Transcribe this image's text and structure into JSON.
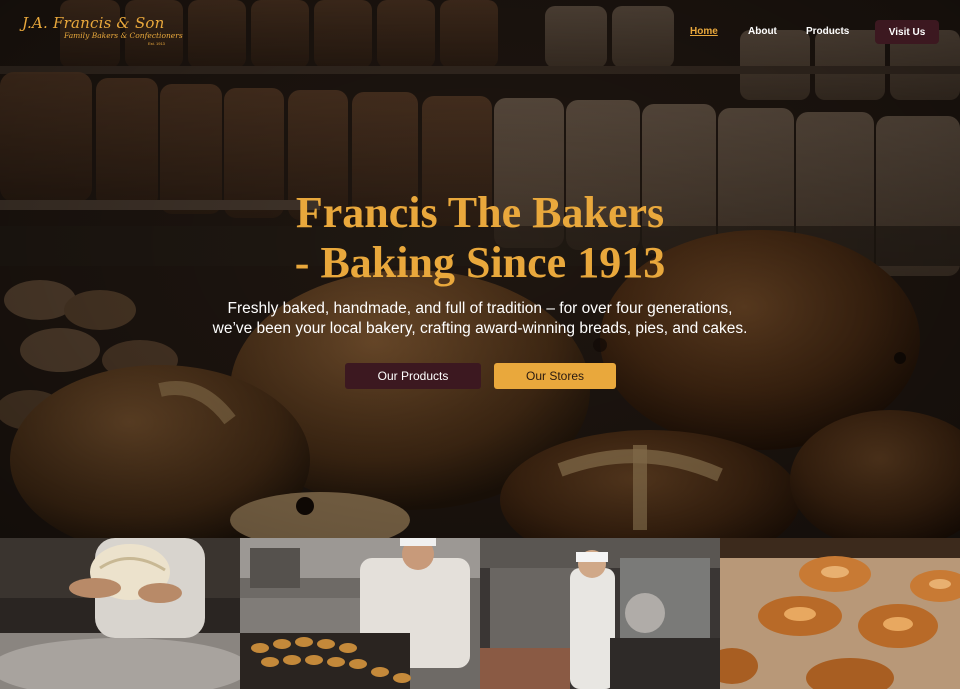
{
  "brand": {
    "logo_main": "J.A. Francis & Son",
    "logo_sub": "Family Bakers & Confectioners",
    "logo_est": "Est. 1913"
  },
  "nav": {
    "links": [
      {
        "label": "Home",
        "active": true
      },
      {
        "label": "About",
        "active": false
      },
      {
        "label": "Products",
        "active": false
      }
    ],
    "cta": "Visit Us"
  },
  "hero": {
    "title_line1": "Francis The Bakers",
    "title_line2": "- Baking Since 1913",
    "subtitle_line1": "Freshly baked, handmade, and full of tradition – for over four generations,",
    "subtitle_line2": "we’ve been your local bakery, crafting award-winning breads, pies, and cakes.",
    "primary_button": "Our Products",
    "secondary_button": "Our Stores"
  },
  "gallery": [
    {
      "icon": "dough-photo"
    },
    {
      "icon": "baker-tarts-photo"
    },
    {
      "icon": "baker-kitchen-photo"
    },
    {
      "icon": "pastry-swirls-photo"
    }
  ],
  "colors": {
    "accent": "#e9a83c",
    "dark": "#3c1820",
    "text": "#ffffff"
  }
}
